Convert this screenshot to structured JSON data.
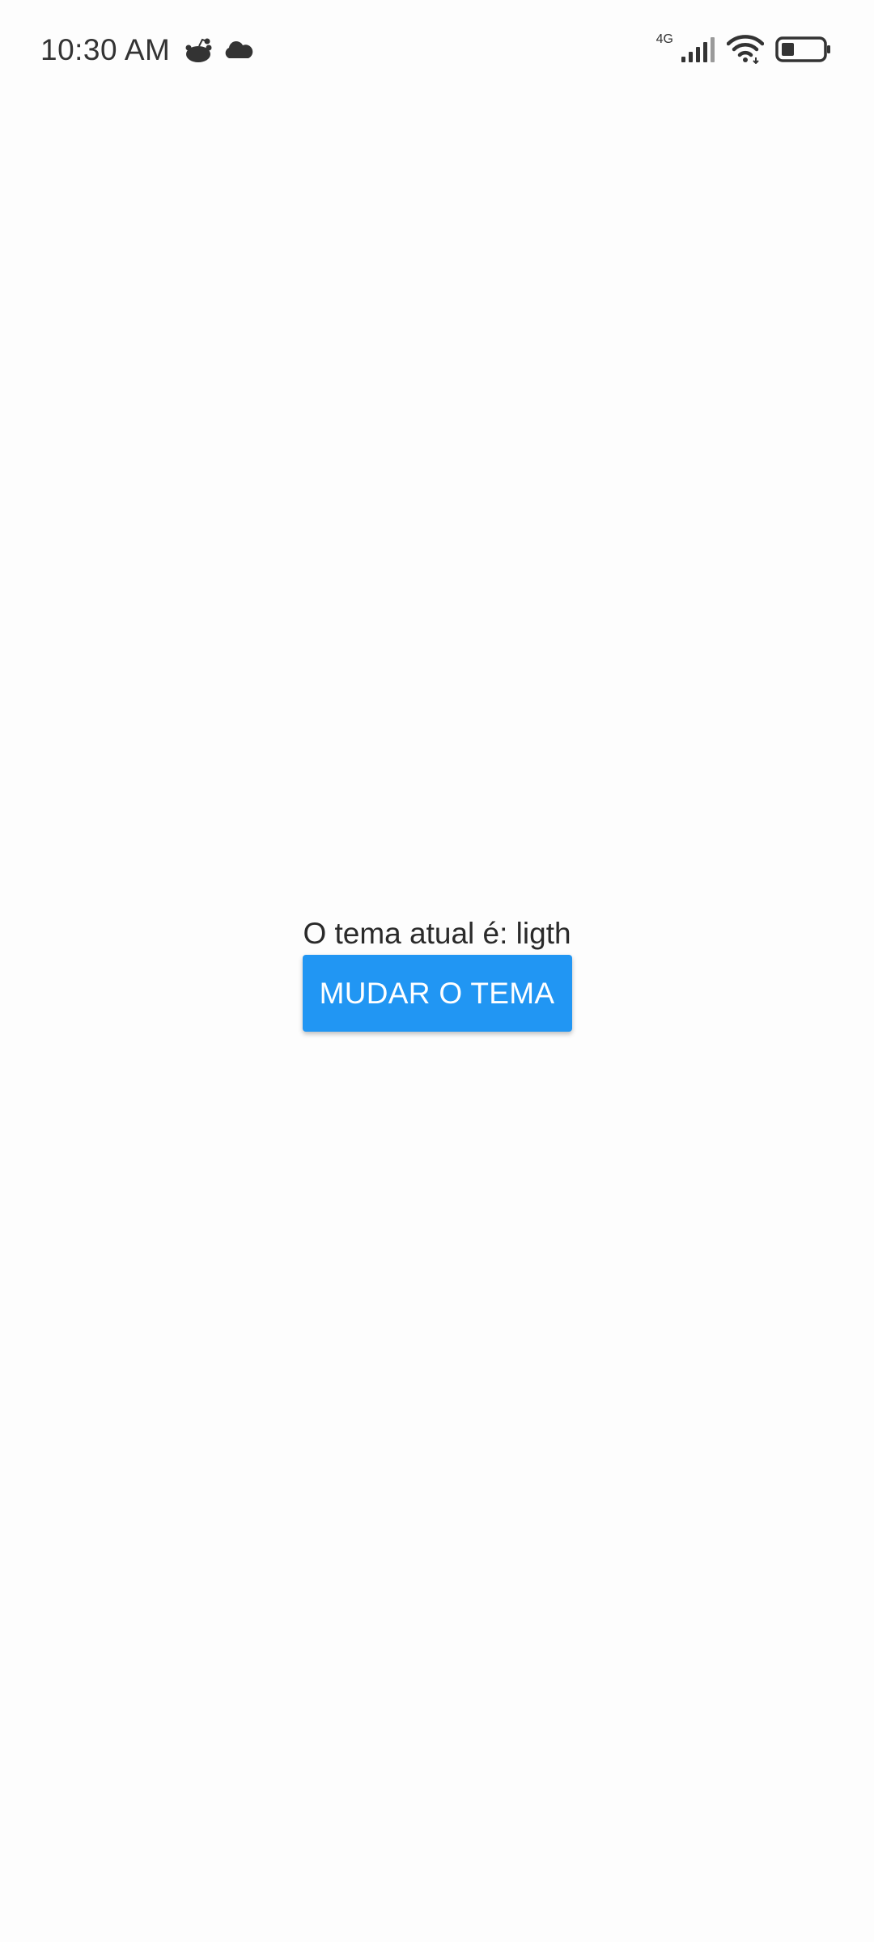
{
  "status_bar": {
    "time": "10:30 AM",
    "network_type": "4G",
    "left_icons": [
      "reddit-icon",
      "cloud-icon"
    ],
    "right_icons": [
      "signal-icon",
      "wifi-icon",
      "battery-icon"
    ]
  },
  "main": {
    "theme_text": "O tema atual é: ligth",
    "button_label": "MUDAR O TEMA"
  },
  "colors": {
    "background": "#fdfdfd",
    "button": "#2196f3",
    "button_text": "#ffffff",
    "text": "#2a2a2a"
  }
}
